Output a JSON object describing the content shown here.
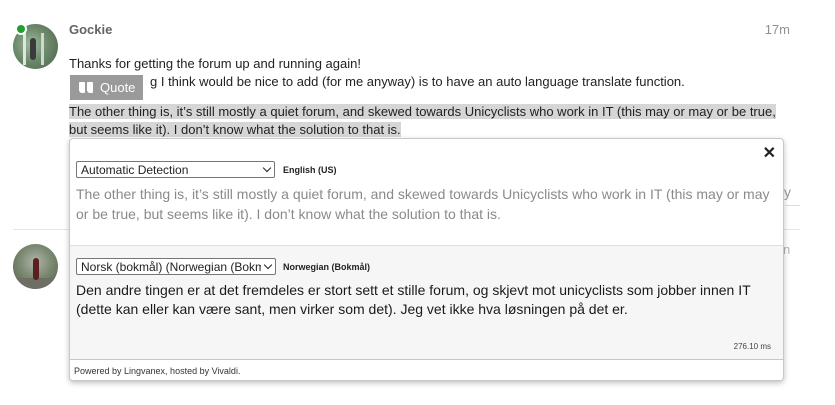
{
  "post1": {
    "username": "Gockie",
    "timestamp": "17m",
    "line1": "Thanks for getting the forum up and running again!",
    "line2_visible": "g I think would be nice to add (for me anyway) is to have an auto language translate function.",
    "selected_text": "The other thing is, it’s still mostly a quiet forum, and skewed towards Unicyclists who work in IT (this may or may or be true, but seems like it). I don’t know what the solution to that is.",
    "quote_button_label": "Quote"
  },
  "post2": {
    "partial_timestamp": "n"
  },
  "background_fragment": "y",
  "translator": {
    "source_language": "Automatic Detection",
    "detected_language": "English (US)",
    "source_text": "The other thing is, it’s still mostly a quiet forum, and skewed towards Unicyclists who work in IT (this may or may or be true, but seems like it). I don’t know what the solution to that is.",
    "target_language": "Norsk (bokmål) (Norwegian (Bokmål))",
    "target_language_label": "Norwegian (Bokmål)",
    "translated_text": "Den andre tingen er at det fremdeles er stort sett et stille forum, og skjevt mot unicyclists som jobber innen IT (dette kan eller kan være sant, men virker som det). Jeg vet ikke hva løsningen på det er.",
    "timing": "276.10 ms",
    "footer": "Powered by Lingvanex, hosted by Vivaldi.",
    "close_icon": "✕"
  },
  "colors": {
    "online": "#1fa12f",
    "quote_button": "#9a9a9a",
    "selection": "#d6d6d6"
  }
}
